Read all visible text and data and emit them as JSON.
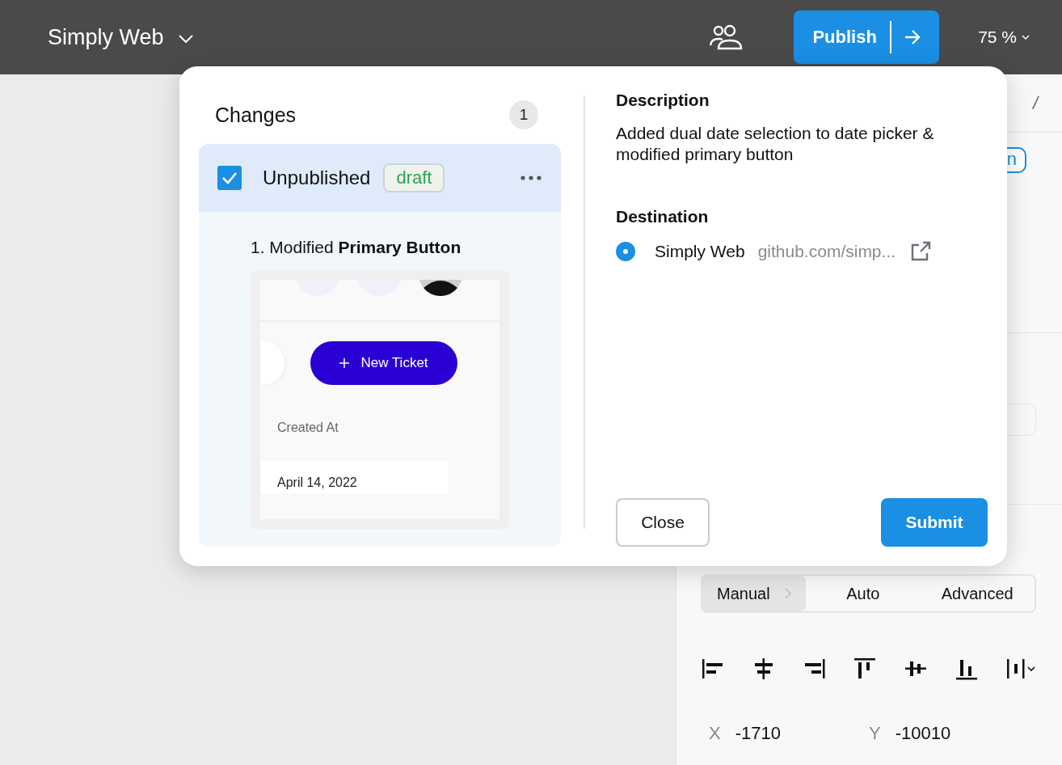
{
  "topbar": {
    "project": "Simply Web",
    "publish": "Publish",
    "zoom": "75 %"
  },
  "side_panel": {
    "breadcrumb": "/",
    "button_fragment": "n",
    "segments": [
      {
        "label": "Manual",
        "selected": true
      },
      {
        "label": "Auto",
        "selected": false
      },
      {
        "label": "Advanced",
        "selected": false
      }
    ],
    "align_tools": [
      {
        "kind": "left"
      },
      {
        "kind": "hcenter"
      },
      {
        "kind": "right"
      },
      {
        "kind": "top"
      },
      {
        "kind": "vcenter"
      },
      {
        "kind": "bottom"
      },
      {
        "kind": "distribute"
      }
    ],
    "x_label": "X",
    "x_value": "-1710",
    "y_label": "Y",
    "y_value": "-10010"
  },
  "modal": {
    "changes_title": "Changes",
    "count": "1",
    "change": {
      "checked": true,
      "title": "Unpublished",
      "badge": "draft",
      "item": "1. Modified **Primary Button**",
      "preview": {
        "button": "New Ticket",
        "field_label": "Created At",
        "field_value": "April 14, 2022"
      }
    },
    "description_label": "Description",
    "description": "Added dual date selection to date picker & modified primary button",
    "destination_label": "Destination",
    "destinations": [
      {
        "name": "Simply Web",
        "url": "github.com/simp...",
        "selected": true
      }
    ],
    "buttons": [
      {
        "label": "Close",
        "kind": "secondary"
      },
      {
        "label": "Submit",
        "kind": "primary"
      }
    ]
  }
}
